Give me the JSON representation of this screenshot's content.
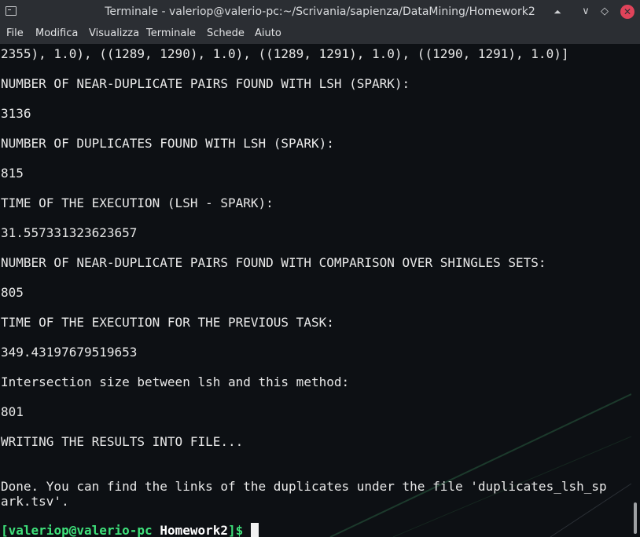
{
  "window": {
    "title": "Terminale - valeriop@valerio-pc:~/Scrivania/sapienza/DataMining/Homework2",
    "app_icon": "terminal-icon",
    "controls": {
      "up_icon": "⏶",
      "minimize_icon": "∨",
      "maximize_icon": "◇",
      "close_icon": "✕"
    },
    "close_color": "#e0435a"
  },
  "menu": [
    "File",
    "Modifica",
    "Visualizza",
    "Terminale",
    "Schede",
    "Aiuto"
  ],
  "terminal": {
    "lines": [
      "2355), 1.0), ((1289, 1290), 1.0), ((1289, 1291), 1.0), ((1290, 1291), 1.0)]",
      "NUMBER OF NEAR-DUPLICATE PAIRS FOUND WITH LSH (SPARK):",
      "3136",
      "NUMBER OF DUPLICATES FOUND WITH LSH (SPARK):",
      "815",
      "TIME OF THE EXECUTION (LSH - SPARK):",
      "31.557331323623657",
      "NUMBER OF NEAR-DUPLICATE PAIRS FOUND WITH COMPARISON OVER SHINGLES SETS:",
      "805",
      "TIME OF THE EXECUTION FOR THE PREVIOUS TASK:",
      "349.43197679519653",
      "Intersection size between lsh and this method:",
      "801",
      "WRITING THE RESULTS INTO FILE...",
      "Done. You can find the links of the duplicates under the file 'duplicates_lsh_sp",
      "ark.tsv'."
    ],
    "prompt": {
      "open": "[",
      "user_host": "valeriop@valerio-pc",
      "dir": "Homework2",
      "close": "]$"
    }
  },
  "colors": {
    "background": "#0d1014",
    "text": "#e9e9e9",
    "prompt_green": "#3ee07a",
    "chrome": "#2b2e33"
  }
}
